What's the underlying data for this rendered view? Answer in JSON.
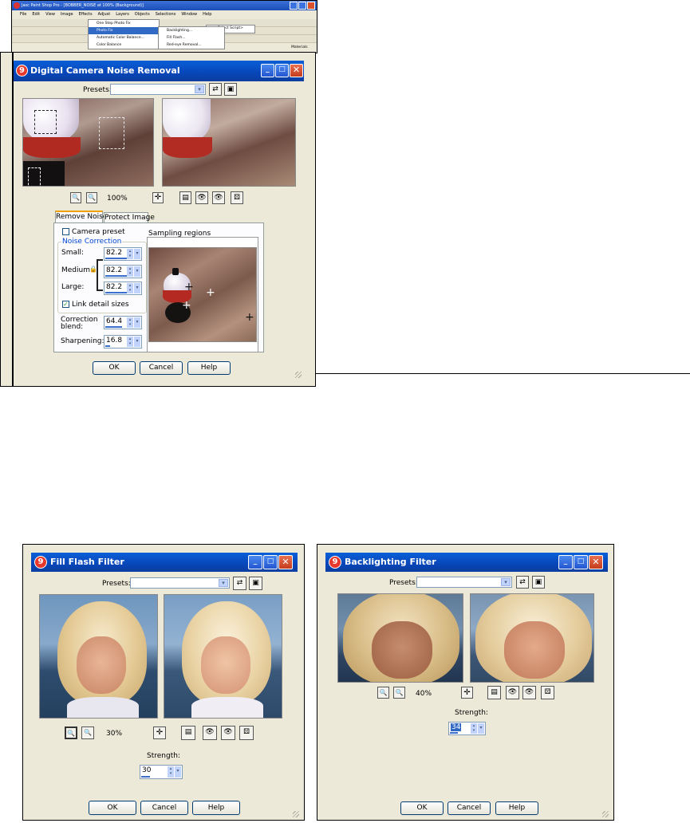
{
  "app": {
    "title": "Jasc Paint Shop Pro - [BOBBER_NOISE at 100% (Background)]",
    "menu": [
      "File",
      "Edit",
      "View",
      "Image",
      "Effects",
      "Adjust",
      "Layers",
      "Objects",
      "Selections",
      "Window",
      "Help"
    ],
    "adjust_menu": [
      "One Step Photo Fix",
      "Photo Fix",
      "Automatic Color Balance...",
      "Color Balance"
    ],
    "photofix_submenu": [
      "Backlighting...",
      "Fill Flash...",
      "Red-eye Removal..."
    ],
    "script_select": "<Select Script>",
    "materials_label": "Materials"
  },
  "noise_dialog": {
    "title": "Digital Camera Noise Removal",
    "presets_label": "Presets:",
    "presets_value": "",
    "zoom": "100%",
    "tabs": [
      "Remove Noise",
      "Protect Image"
    ],
    "camera_preset_label": "Camera preset",
    "group_label": "Noise Correction",
    "small_label": "Small:",
    "small_value": "82.2",
    "medium_label": "Medium:",
    "medium_value": "82.2",
    "large_label": "Large:",
    "large_value": "82.2",
    "link_label": "Link detail sizes",
    "blend_label": "Correction blend:",
    "blend_value": "64.4",
    "sharpen_label": "Sharpening:",
    "sharpen_value": "16.8",
    "sampling_label": "Sampling regions",
    "ok": "OK",
    "cancel": "Cancel",
    "help": "Help"
  },
  "fill_dialog": {
    "title": "Fill Flash Filter",
    "presets_label": "Presets:",
    "zoom": "30%",
    "strength_label": "Strength:",
    "strength_value": "30",
    "ok": "OK",
    "cancel": "Cancel",
    "help": "Help"
  },
  "back_dialog": {
    "title": "Backlighting Filter",
    "presets_label": "Presets:",
    "zoom": "40%",
    "strength_label": "Strength:",
    "strength_value": "34",
    "ok": "OK",
    "cancel": "Cancel",
    "help": "Help"
  },
  "colors": {
    "title_blue": "#0846b8",
    "dialog_bg": "#ece9d8",
    "close_red": "#c43c1c"
  }
}
